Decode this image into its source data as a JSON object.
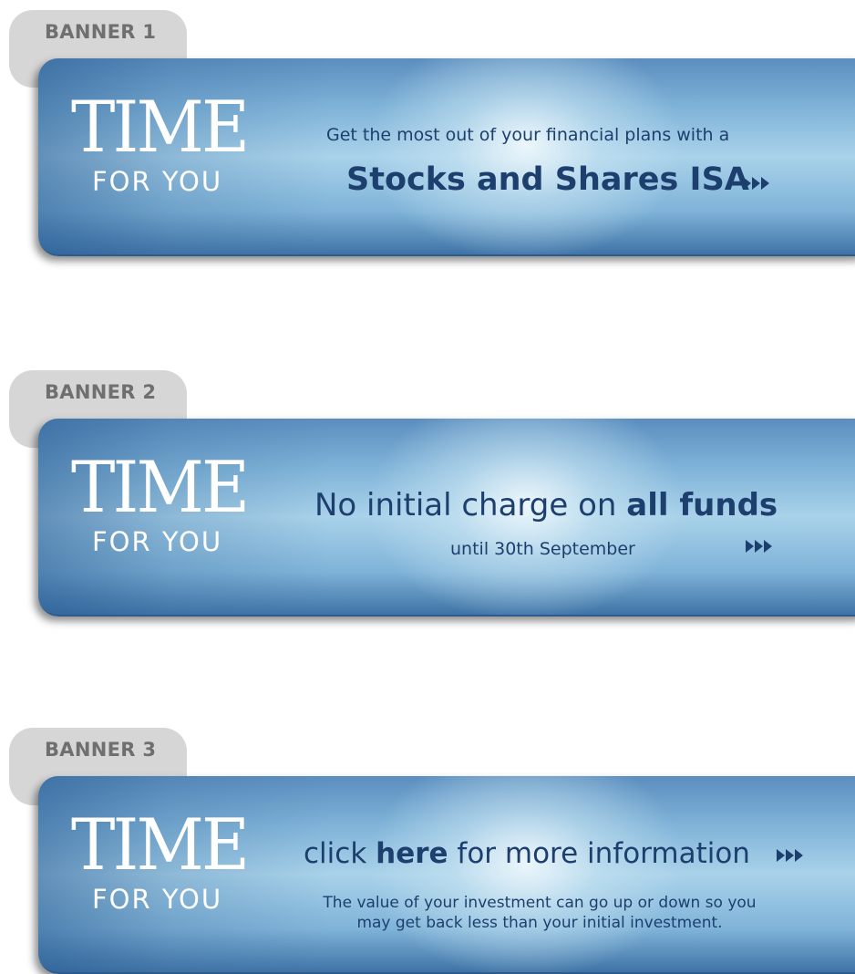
{
  "banners": [
    {
      "tab_label": "BANNER 1",
      "logo_main": "TIME",
      "logo_sub": "FOR YOU",
      "line1": "Get the most out of your financial plans with a",
      "line2": "Stocks and Shares ISA"
    },
    {
      "tab_label": "BANNER 2",
      "logo_main": "TIME",
      "logo_sub": "FOR YOU",
      "line1_pre": "No initial charge on ",
      "line1_bold": "all funds",
      "line2": "until 30th September"
    },
    {
      "tab_label": "BANNER 3",
      "logo_main": "TIME",
      "logo_sub": "FOR YOU",
      "line1_pre": "click ",
      "line1_bold": "here",
      "line1_post": " for more information",
      "disclaimer": "The value of your investment can go up or down so you may get back less than your initial investment."
    }
  ],
  "colors": {
    "tab_background": "#d6d6d6",
    "tab_text": "#6f6f6f",
    "banner_text": "#1d3f6e",
    "logo_text": "#ffffff"
  },
  "icons": {
    "arrow": "triple-right-arrow-icon"
  }
}
